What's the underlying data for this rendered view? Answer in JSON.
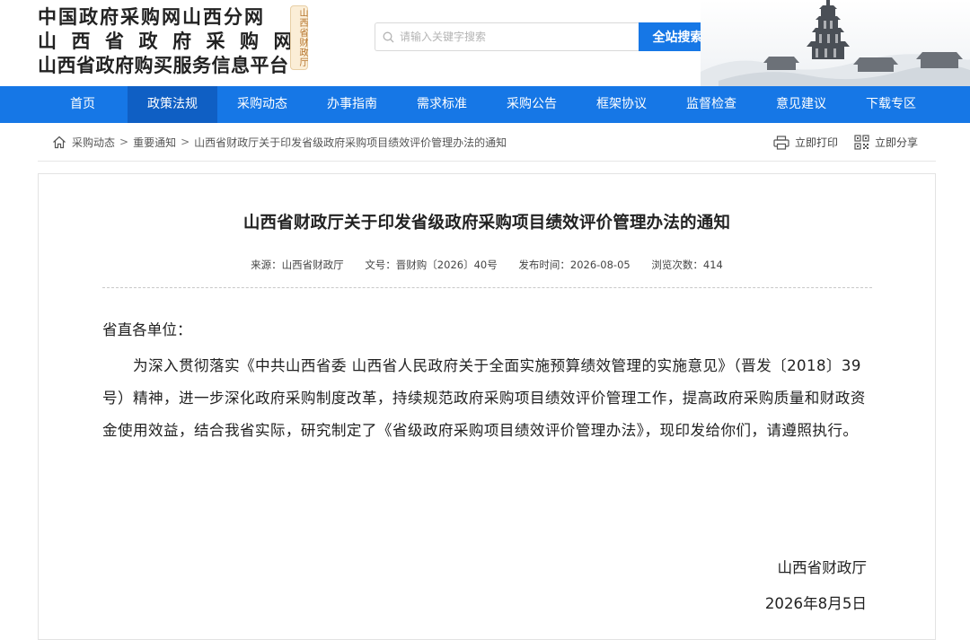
{
  "header": {
    "title_lines": [
      "中国政府采购网山西分网",
      "山西省政府采购网",
      "山西省政府购买服务信息平台"
    ],
    "seal_text": "山西省财政厅",
    "search": {
      "placeholder": "请输入关键字搜索",
      "button_label": "全站搜索"
    }
  },
  "nav": {
    "items": [
      {
        "label": "首页"
      },
      {
        "label": "政策法规",
        "active": true
      },
      {
        "label": "采购动态"
      },
      {
        "label": "办事指南"
      },
      {
        "label": "需求标准"
      },
      {
        "label": "采购公告"
      },
      {
        "label": "框架协议"
      },
      {
        "label": "监督检查"
      },
      {
        "label": "意见建议"
      },
      {
        "label": "下载专区"
      }
    ]
  },
  "breadcrumb": {
    "items": [
      "采购动态",
      "重要通知"
    ],
    "separator": ">",
    "current": "山西省财政厅关于印发省级政府采购项目绩效评价管理办法的通知"
  },
  "actions": {
    "print_label": "立即打印",
    "share_label": "立即分享"
  },
  "article": {
    "title": "山西省财政厅关于印发省级政府采购项目绩效评价管理办法的通知",
    "meta": {
      "source": "来源：山西省财政厅",
      "doc_no": "文号：晋财购〔2026〕40号",
      "published": "发布时间：2026-08-05",
      "views": "浏览次数：414"
    },
    "salutation": "省直各单位：",
    "paragraph": "为深入贯彻落实《中共山西省委 山西省人民政府关于全面实施预算绩效管理的实施意见》（晋发〔2018〕39号）精神，进一步深化政府采购制度改革，持续规范政府采购项目绩效评价管理工作，提高政府采购质量和财政资金使用效益，结合我省实际，研究制定了《省级政府采购项目绩效评价管理办法》，现印发给你们，请遵照执行。",
    "signature": {
      "org": "山西省财政厅",
      "date": "2026年8月5日"
    }
  },
  "colors": {
    "primary": "#1677e6",
    "nav_active": "#0f5fc4",
    "seal_bg": "#fbeed7",
    "seal_text": "#b5742e"
  }
}
